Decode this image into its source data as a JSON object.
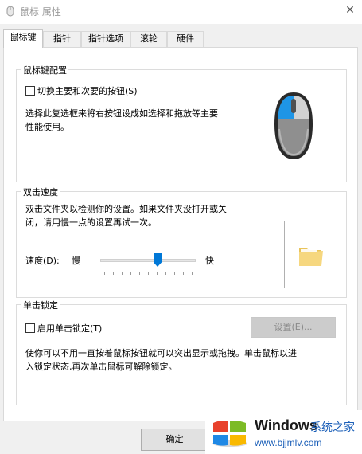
{
  "window": {
    "title": "鼠标 属性",
    "close_glyph": "✕"
  },
  "tabs": [
    "鼠标键",
    "指针",
    "指针选项",
    "滚轮",
    "硬件"
  ],
  "button_config": {
    "group_title": "鼠标键配置",
    "swap_label": "切换主要和次要的按钮(S)",
    "description_line1": "选择此复选框来将右按钮设成如选择和拖放等主要",
    "description_line2": "性能使用。"
  },
  "double_click": {
    "group_title": "双击速度",
    "description_line1": "双击文件夹以检测你的设置。如果文件夹没打开或关",
    "description_line2": "闭，请用慢一点的设置再试一次。",
    "speed_label": "速度(D):",
    "slow_label": "慢",
    "fast_label": "快",
    "speed_value_fraction": 0.6
  },
  "click_lock": {
    "group_title": "单击锁定",
    "enable_label": "启用单击锁定(T)",
    "settings_button": "设置(E)...",
    "description_line1": "使你可以不用一直按着鼠标按钮就可以突出显示或拖拽。单击鼠标以进",
    "description_line2": "入锁定状态,再次单击鼠标可解除锁定。"
  },
  "footer": {
    "ok_button": "确定"
  },
  "watermark": {
    "brand": "Windows",
    "brand_cn": "系统之家",
    "url": "www.bjjmlv.com"
  }
}
